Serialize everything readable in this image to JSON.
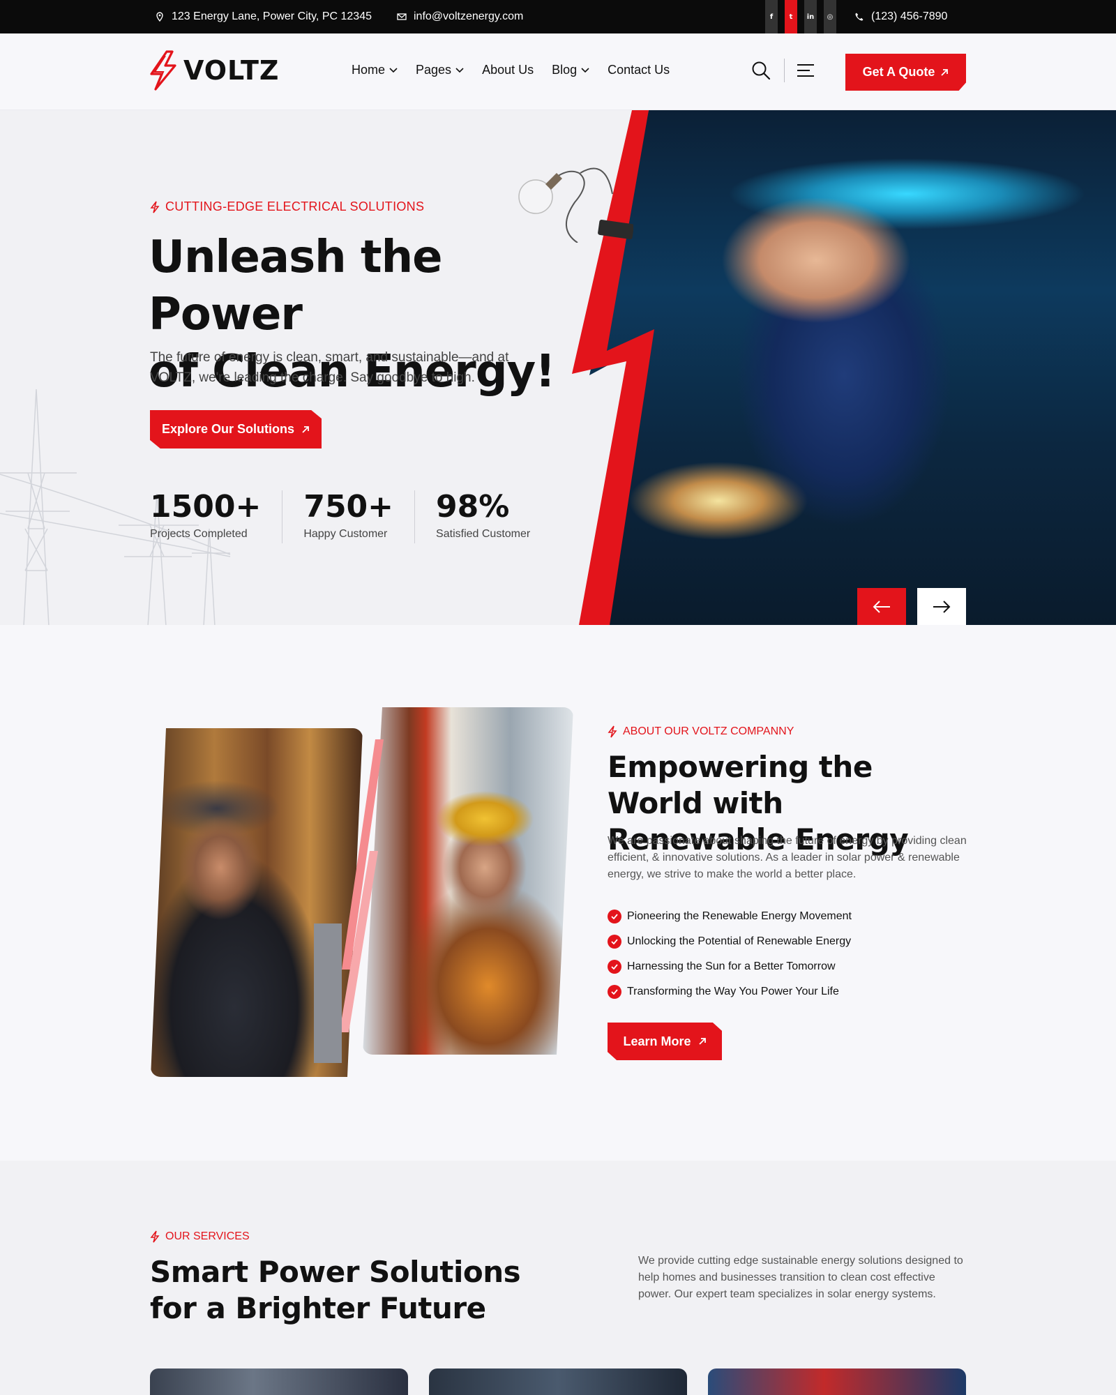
{
  "topbar": {
    "address": "123 Energy Lane, Power City, PC 12345",
    "email": "info@voltzenergy.com",
    "phone": "(123) 456-7890",
    "socials": [
      {
        "icon": "facebook-icon",
        "glyph": "f"
      },
      {
        "icon": "twitter-icon",
        "glyph": "t"
      },
      {
        "icon": "linkedin-icon",
        "glyph": "in"
      },
      {
        "icon": "instagram-icon",
        "glyph": "◎"
      }
    ]
  },
  "header": {
    "brand": "VOLTZ",
    "nav": [
      {
        "label": "Home",
        "dropdown": true
      },
      {
        "label": "Pages",
        "dropdown": true
      },
      {
        "label": "About Us",
        "dropdown": false
      },
      {
        "label": "Blog",
        "dropdown": true
      },
      {
        "label": "Contact Us",
        "dropdown": false
      }
    ],
    "cta": "Get A Quote"
  },
  "hero": {
    "tagline": "CUTTING-EDGE ELECTRICAL SOLUTIONS",
    "title_line1": "Unleash the Power",
    "title_line2": "of Clean Energy!",
    "description": "The future of energy is clean, smart, and sustainable—and at VOLTZ, we're leading the charge. Say goodbye to high.",
    "button": "Explore Our Solutions",
    "stats": [
      {
        "value": "1500+",
        "label": "Projects Completed"
      },
      {
        "value": "750+",
        "label": "Happy Customer"
      },
      {
        "value": "98%",
        "label": "Satisfied Customer"
      }
    ]
  },
  "about": {
    "tagline": "ABOUT OUR VOLTZ COMPANNY",
    "title": "Empowering the World with Renewable Energy",
    "description": "We are passionate about shaping the future of energy by providing clean efficient, & innovative solutions. As a leader in solar power & renewable energy, we strive to make the world a better place.",
    "checklist": [
      "Pioneering the Renewable Energy Movement",
      "Unlocking the Potential of Renewable Energy",
      "Harnessing the Sun for a Better Tomorrow",
      "Transforming the Way You Power Your Life"
    ],
    "button": "Learn More"
  },
  "services": {
    "tagline": "OUR SERVICES",
    "title": "Smart Power Solutions for a Brighter Future",
    "description": "We provide cutting edge sustainable energy solutions designed to help homes and businesses transition to clean cost effective power. Our expert team specializes in solar energy systems."
  },
  "colors": {
    "accent": "#e3141b",
    "topbar_bg": "#0b0b0b",
    "text": "#111111"
  }
}
